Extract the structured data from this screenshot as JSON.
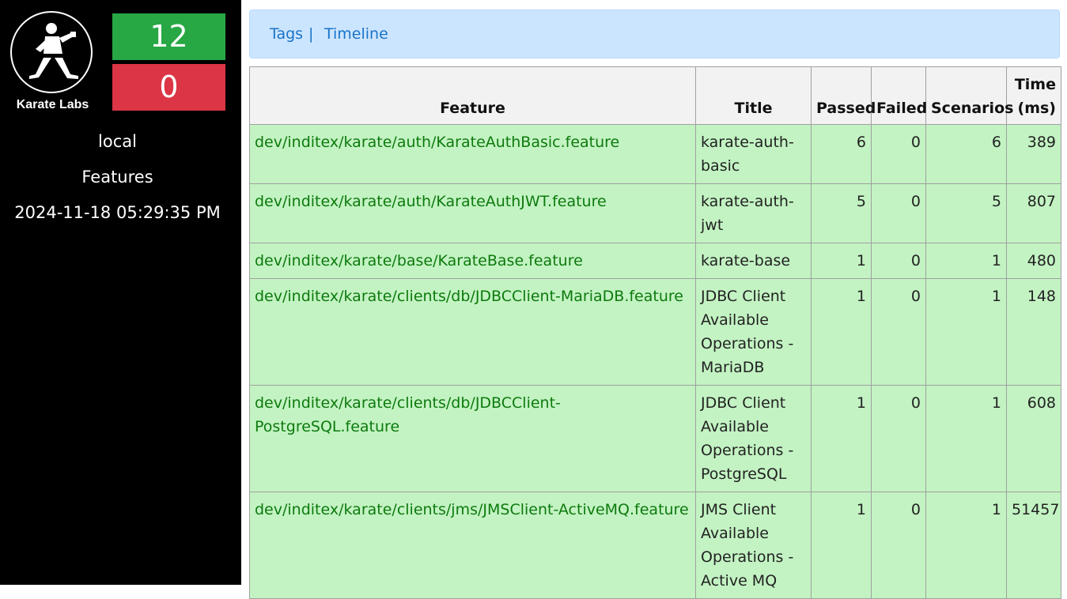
{
  "sidebar": {
    "logo_text": "Karate Labs",
    "passed_count": "12",
    "failed_count": "0",
    "environment": "local",
    "features_label": "Features",
    "datetime": "2024-11-18 05:29:35 PM"
  },
  "nav": {
    "tags": "Tags",
    "separator": "|",
    "timeline": "Timeline"
  },
  "table": {
    "headers": [
      "Feature",
      "Title",
      "Passed",
      "Failed",
      "Scenarios",
      "Time (ms)"
    ],
    "rows": [
      {
        "feature": "dev/inditex/karate/auth/KarateAuthBasic.feature",
        "title": "karate-auth-basic",
        "passed": "6",
        "failed": "0",
        "scenarios": "6",
        "time": "389"
      },
      {
        "feature": "dev/inditex/karate/auth/KarateAuthJWT.feature",
        "title": "karate-auth-jwt",
        "passed": "5",
        "failed": "0",
        "scenarios": "5",
        "time": "807"
      },
      {
        "feature": "dev/inditex/karate/base/KarateBase.feature",
        "title": "karate-base",
        "passed": "1",
        "failed": "0",
        "scenarios": "1",
        "time": "480"
      },
      {
        "feature": "dev/inditex/karate/clients/db/JDBCClient-MariaDB.feature",
        "title": "JDBC Client Available Operations - MariaDB",
        "passed": "1",
        "failed": "0",
        "scenarios": "1",
        "time": "148"
      },
      {
        "feature": "dev/inditex/karate/clients/db/JDBCClient-PostgreSQL.feature",
        "title": "JDBC Client Available Operations - PostgreSQL",
        "passed": "1",
        "failed": "0",
        "scenarios": "1",
        "time": "608"
      },
      {
        "feature": "dev/inditex/karate/clients/jms/JMSClient-ActiveMQ.feature",
        "title": "JMS Client Available Operations - Active MQ",
        "passed": "1",
        "failed": "0",
        "scenarios": "1",
        "time": "51457"
      }
    ]
  },
  "colors": {
    "passed": "#28a745",
    "failed": "#dc3545",
    "row_background": "#c3f3c3",
    "feature_link": "#0d7a0d",
    "nav_background": "#cce5ff"
  }
}
